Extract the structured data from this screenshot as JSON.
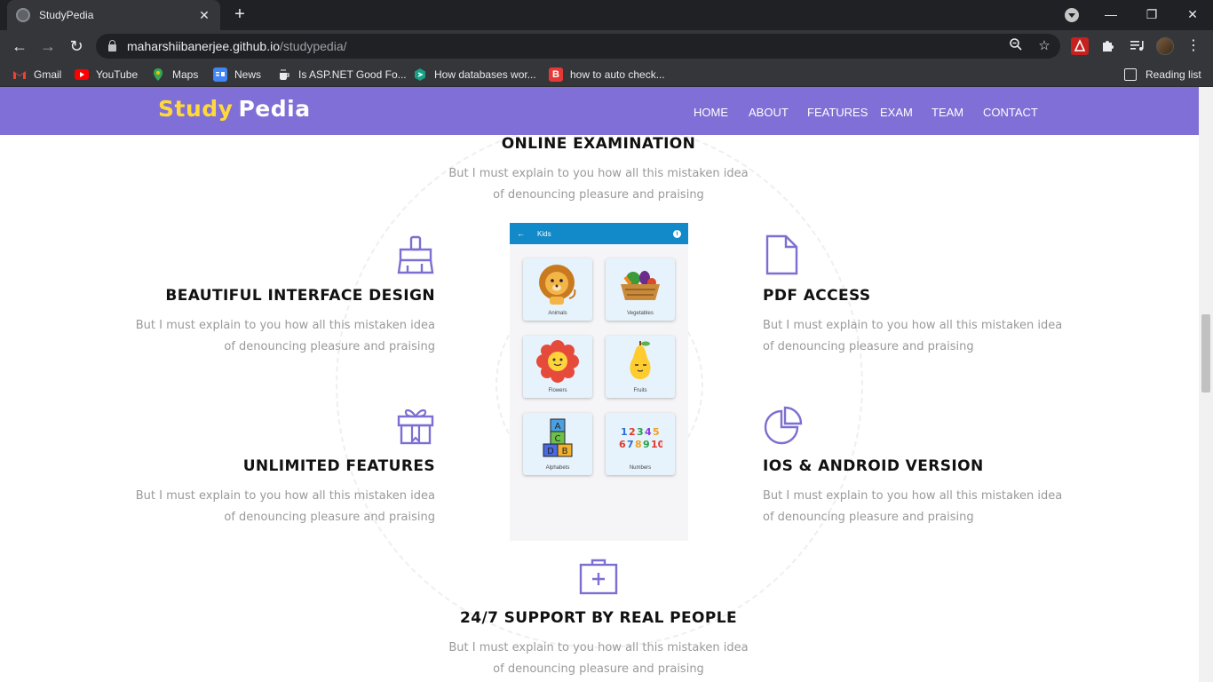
{
  "browser": {
    "tab_title": "StudyPedia",
    "tab_close": "✕",
    "new_tab": "+",
    "url_host": "maharshiibanerjee.github.io",
    "url_path": "/studypedia/",
    "window": {
      "minimize": "—",
      "maximize": "❐",
      "close": "✕"
    },
    "nav": {
      "back": "←",
      "forward": "→",
      "reload": "↻"
    },
    "bookmarks": [
      {
        "label": "Gmail",
        "icon": "gmail-icon",
        "color": "#ea4335"
      },
      {
        "label": "YouTube",
        "icon": "youtube-icon",
        "color": "#ff0000"
      },
      {
        "label": "Maps",
        "icon": "maps-icon",
        "color": "#34a853"
      },
      {
        "label": "News",
        "icon": "news-icon",
        "color": "#4285f4"
      },
      {
        "label": "Is ASP.NET Good Fo...",
        "icon": "coffee-icon",
        "color": "#dddddd"
      },
      {
        "label": "How databases wor...",
        "icon": "educative-icon",
        "color": "#16a085"
      },
      {
        "label": "how to auto check...",
        "icon": "bing-icon",
        "color": "#e53935"
      }
    ],
    "reading_list": "Reading list"
  },
  "site": {
    "logo_part1": "Study",
    "logo_part2": "Pedia",
    "brand_color": "#7f6fd6",
    "menu": [
      "HOME",
      "ABOUT",
      "FEATURES",
      "EXAM",
      "TEAM",
      "CONTACT"
    ]
  },
  "features": {
    "top": {
      "title": "ONLINE EXAMINATION",
      "line1": "But I must explain to you how all this mistaken idea",
      "line2": "of denouncing pleasure and praising"
    },
    "left1": {
      "title": "BEAUTIFUL INTERFACE DESIGN",
      "icon": "paint-brush-icon",
      "line1": "But I must explain to you how all this mistaken idea",
      "line2": "of denouncing pleasure and praising"
    },
    "left2": {
      "title": "UNLIMITED FEATURES",
      "icon": "gift-icon",
      "line1": "But I must explain to you how all this mistaken idea",
      "line2": "of denouncing pleasure and praising"
    },
    "right1": {
      "title": "PDF ACCESS",
      "icon": "document-icon",
      "line1": "But I must explain to you how all this mistaken idea",
      "line2": "of denouncing pleasure and praising"
    },
    "right2": {
      "title": "IOS & ANDROID VERSION",
      "icon": "pie-chart-icon",
      "line1": "But I must explain to you how all this mistaken idea",
      "line2": "of denouncing pleasure and praising"
    },
    "bottom": {
      "title": "24/7 SUPPORT BY REAL PEOPLE",
      "icon": "first-aid-kit-icon",
      "line1": "But I must explain to you how all this mistaken idea",
      "line2": "of denouncing pleasure and praising"
    }
  },
  "phone": {
    "appbar_title": "Kids",
    "back": "←",
    "info": "i",
    "cards": [
      "Animals",
      "Vegetables",
      "Flowers",
      "Fruits",
      "Alphabets",
      "Numbers"
    ]
  }
}
